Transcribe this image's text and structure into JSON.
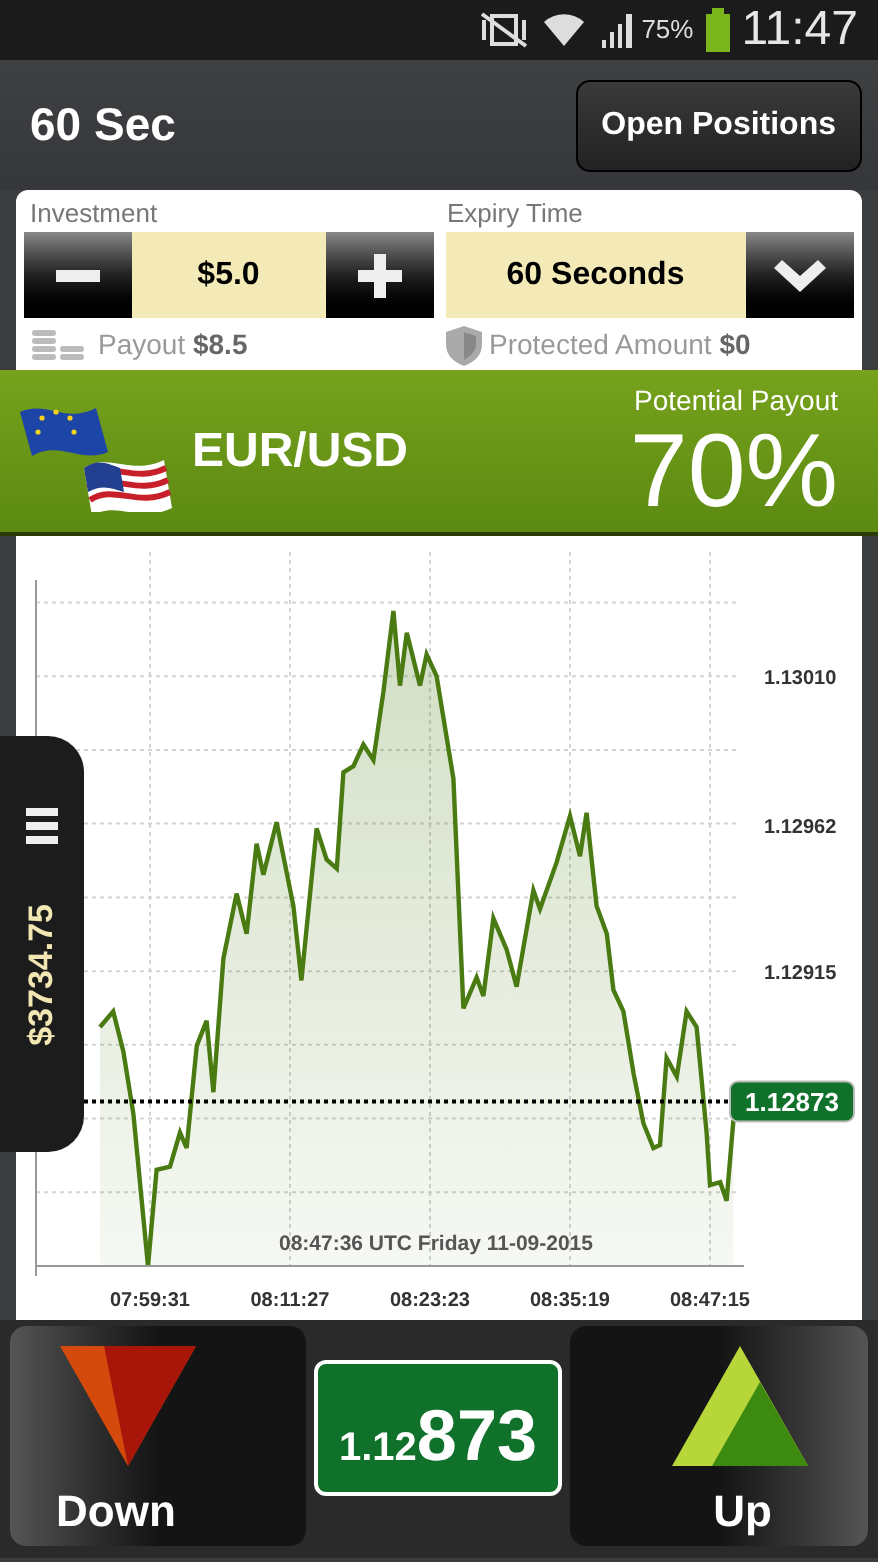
{
  "status_bar": {
    "battery": "75%",
    "time": "11:47"
  },
  "header": {
    "title": "60 Sec",
    "button": "Open Positions"
  },
  "investment": {
    "label": "Investment",
    "value": "$5.0",
    "payout": "Payout **$8.5**"
  },
  "expiry": {
    "label": "Expiry Time",
    "value": "60 Seconds",
    "protected": "Protected Amount **$0**"
  },
  "asset": {
    "name": "EUR/USD",
    "payout_label": "Potential Payout",
    "payout_value": "70%"
  },
  "side_tab": {
    "balance": "$3734.75"
  },
  "chart": {
    "timestamp": "08:47:36 UTC Friday 11-09-2015",
    "chart_data": {
      "type": "area",
      "grid": true,
      "x": [
        28515,
        28583,
        28635,
        28686,
        28761,
        28805,
        28873,
        28924,
        28958,
        29010,
        29061,
        29095,
        29146,
        29214,
        29265,
        29316,
        29351,
        29419,
        29504,
        29545,
        29623,
        29674,
        29726,
        29760,
        29811,
        29863,
        29914,
        29965,
        30016,
        30050,
        30084,
        30152,
        30186,
        30237,
        30323,
        30374,
        30442,
        30476,
        30527,
        30595,
        30646,
        30732,
        30766,
        30851,
        30919,
        30970,
        31004,
        31055,
        31107,
        31141,
        31192,
        31244,
        31295,
        31346,
        31380,
        31413,
        31465,
        31516,
        31567,
        31618,
        31635,
        31687,
        31720,
        31755
      ],
      "series": [
        {
          "color": "#4a7a12",
          "values": [
            1.12897,
            1.12902,
            1.12889,
            1.12869,
            1.1282,
            1.12851,
            1.12852,
            1.12863,
            1.12858,
            1.12891,
            1.12899,
            1.12876,
            1.12919,
            1.1294,
            1.12927,
            1.12956,
            1.12946,
            1.12963,
            1.12936,
            1.12912,
            1.12961,
            1.12951,
            1.12948,
            1.12979,
            1.12981,
            1.12988,
            1.12983,
            1.13005,
            1.13031,
            1.13007,
            1.13024,
            1.13007,
            1.13017,
            1.1301,
            1.12977,
            1.12903,
            1.12913,
            1.12907,
            1.12932,
            1.12922,
            1.1291,
            1.12941,
            1.12935,
            1.1295,
            1.12965,
            1.12952,
            1.12966,
            1.12936,
            1.12927,
            1.12909,
            1.12902,
            1.12882,
            1.12866,
            1.12858,
            1.12859,
            1.12887,
            1.12881,
            1.12902,
            1.12897,
            1.12863,
            1.12846,
            1.12847,
            1.12841,
            1.12867
          ]
        }
      ],
      "xlim": [
        28188,
        31758
      ],
      "ylim": [
        1.1282,
        1.13041
      ],
      "xticks": [
        {
          "value": 28771,
          "label": "07:59:31"
        },
        {
          "value": 29487,
          "label": "08:11:27"
        },
        {
          "value": 30203,
          "label": "08:23:23"
        },
        {
          "value": 30919,
          "label": "08:35:19"
        },
        {
          "value": 31635,
          "label": "08:47:15"
        }
      ],
      "yticks": [
        {
          "value": 1.12915,
          "label": "1.12915"
        },
        {
          "value": 1.12962,
          "label": "1.12962"
        },
        {
          "value": 1.1301,
          "label": "1.13010"
        }
      ],
      "ref_lines": [
        {
          "axis": "y",
          "value": 1.12873
        }
      ]
    },
    "current_price": "1.12873"
  },
  "trade": {
    "down": "Down",
    "up": "Up",
    "price_prefix": "1.12",
    "price_main": "873"
  }
}
